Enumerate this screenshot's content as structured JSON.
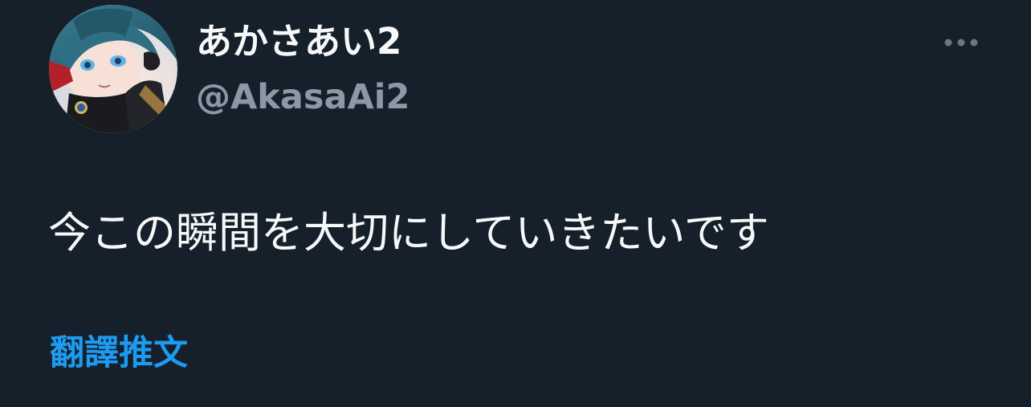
{
  "tweet": {
    "author": {
      "display_name": "あかさあい2",
      "handle": "@AkasaAi2",
      "avatar_icon": "user-avatar-anime-character-icon"
    },
    "more_icon": "more-horizontal-icon",
    "text": "今この瞬間を大切にしていきたいです",
    "translate_label": "翻譯推文"
  },
  "colors": {
    "background": "#15202b",
    "primary_text": "#f7f9f9",
    "secondary_text": "#8b98a5",
    "link": "#1d9bf0"
  }
}
